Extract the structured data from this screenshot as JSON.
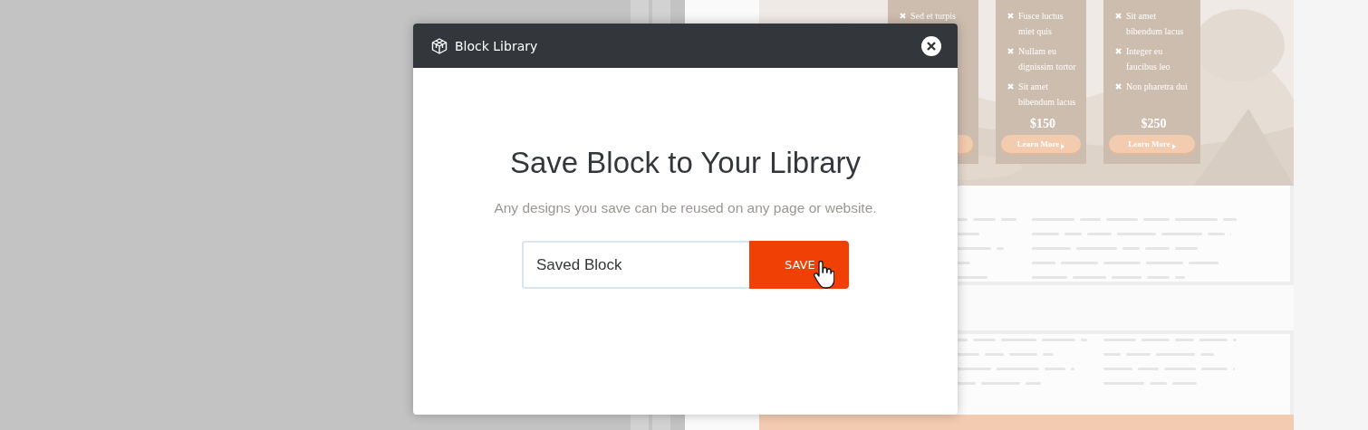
{
  "modal": {
    "title": "Block Library",
    "heading": "Save Block to Your Library",
    "subtitle": "Any designs you save can be reused on any page or website.",
    "name_field": {
      "value": "Saved Block"
    },
    "save_button": "SAVE"
  },
  "background_page": {
    "pricing_cards": [
      {
        "features": [
          "Sed et turpis"
        ]
      },
      {
        "features": [
          "Fusce luctus miet quis",
          "Nullam eu dignissim tortor",
          "Sit amet bibendum lacus"
        ],
        "price": "$150",
        "button": "Learn More"
      },
      {
        "features": [
          "Sit amet bibendum lacus",
          "Integer eu faucibus leo",
          "Non pharetra dui"
        ],
        "price": "$250",
        "button": "Learn More"
      }
    ]
  }
}
